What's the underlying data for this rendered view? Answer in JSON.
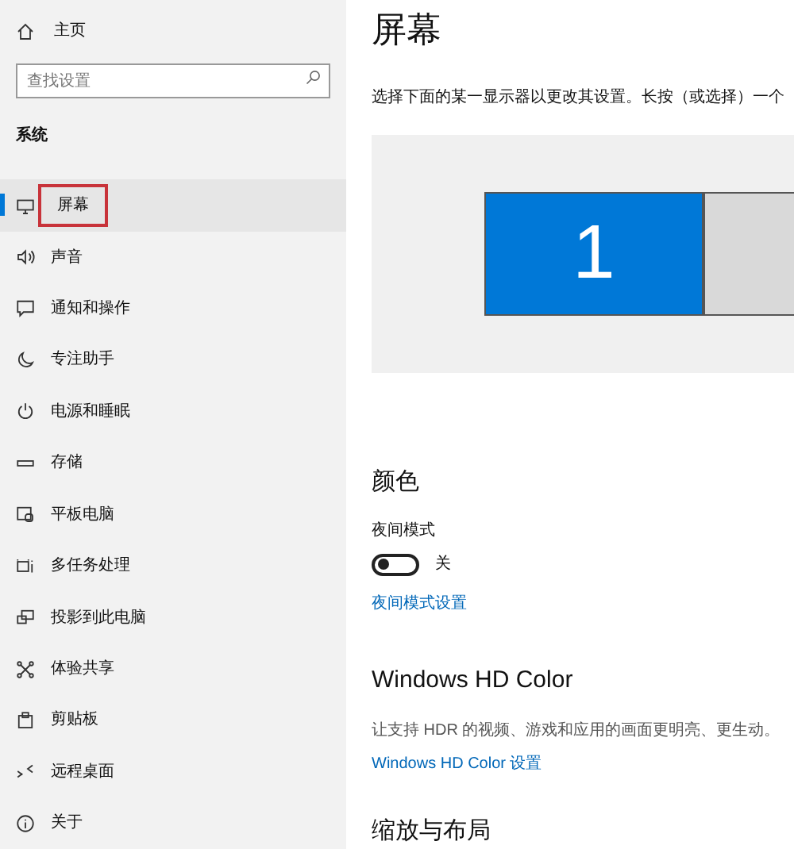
{
  "sidebar": {
    "home": "主页",
    "search": {
      "placeholder": "查找设置"
    },
    "section": "系统",
    "items": [
      {
        "label": "屏幕",
        "selected": true,
        "annotated": true
      },
      {
        "label": "声音",
        "selected": false,
        "annotated": false
      },
      {
        "label": "通知和操作",
        "selected": false,
        "annotated": false
      },
      {
        "label": "专注助手",
        "selected": false,
        "annotated": false
      },
      {
        "label": "电源和睡眠",
        "selected": false,
        "annotated": false
      },
      {
        "label": "存储",
        "selected": false,
        "annotated": false
      },
      {
        "label": "平板电脑",
        "selected": false,
        "annotated": false
      },
      {
        "label": "多任务处理",
        "selected": false,
        "annotated": false
      },
      {
        "label": "投影到此电脑",
        "selected": false,
        "annotated": false
      },
      {
        "label": "体验共享",
        "selected": false,
        "annotated": false
      },
      {
        "label": "剪贴板",
        "selected": false,
        "annotated": false
      },
      {
        "label": "远程桌面",
        "selected": false,
        "annotated": false
      },
      {
        "label": "关于",
        "selected": false,
        "annotated": false
      }
    ]
  },
  "main": {
    "title": "屏幕",
    "description": "选择下面的某一显示器以更改其设置。长按（或选择）一个",
    "monitors": [
      {
        "label": "1",
        "selected": true
      },
      {
        "selected": false
      }
    ],
    "color_section": {
      "heading": "颜色",
      "night_mode": {
        "label": "夜间模式",
        "on": false,
        "state_text": "关"
      },
      "link": "夜间模式设置"
    },
    "hd_section": {
      "heading": "Windows HD Color",
      "description": "让支持 HDR 的视频、游戏和应用的画面更明亮、更生动。",
      "link": "Windows HD Color 设置"
    },
    "scale_heading": "缩放与布局"
  }
}
